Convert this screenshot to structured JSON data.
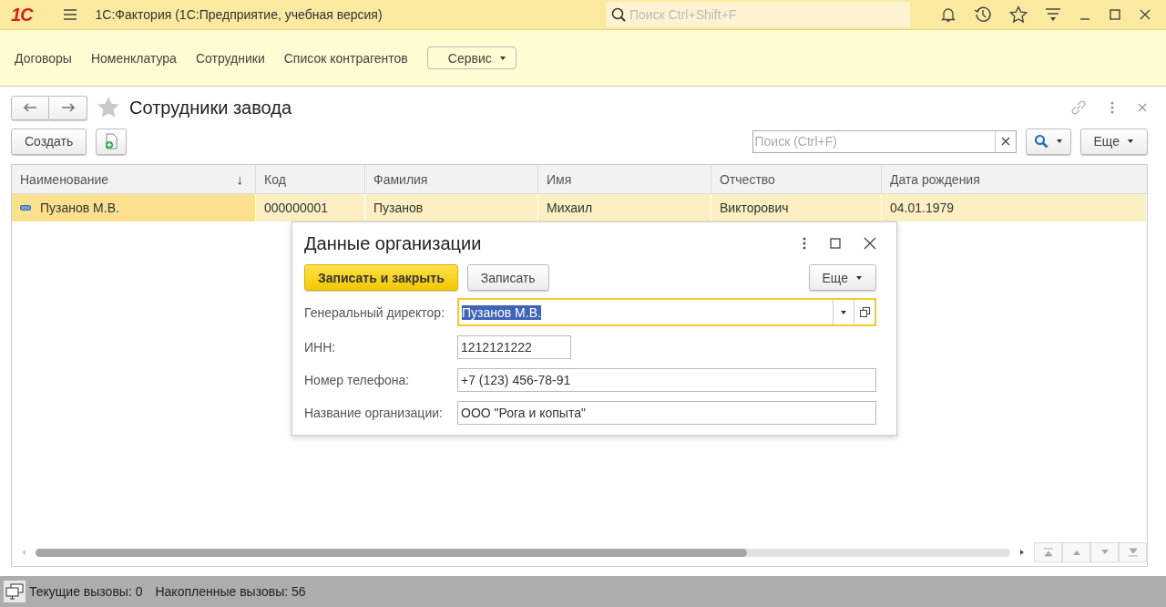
{
  "app": {
    "logo": "1С",
    "title": "1С:Фактория  (1С:Предприятие, учебная версия)"
  },
  "global_search": {
    "placeholder": "Поиск Ctrl+Shift+F"
  },
  "sections": [
    {
      "label": "Договоры"
    },
    {
      "label": "Номенклатура"
    },
    {
      "label": "Сотрудники"
    },
    {
      "label": "Список контрагентов"
    }
  ],
  "service_menu": {
    "label": "Сервис"
  },
  "form": {
    "title": "Сотрудники завода",
    "favorite": false,
    "create_button": "Создать",
    "search": {
      "placeholder": "Поиск (Ctrl+F)"
    },
    "more_button": "Еще"
  },
  "table": {
    "columns": [
      {
        "label": "Наименование",
        "sort_mark": "↓"
      },
      {
        "label": "Код"
      },
      {
        "label": "Фамилия"
      },
      {
        "label": "Имя"
      },
      {
        "label": "Отчество"
      },
      {
        "label": "Дата рождения"
      }
    ],
    "rows": [
      {
        "selected": true,
        "cells": [
          {
            "text": "Пузанов М.В.",
            "current": true
          },
          {
            "text": "000000001",
            "current": false
          },
          {
            "text": "Пузанов",
            "current": false
          },
          {
            "text": "Михаил",
            "current": false
          },
          {
            "text": "Викторович",
            "current": false
          },
          {
            "text": "04.01.1979",
            "current": false
          }
        ]
      }
    ]
  },
  "dialog": {
    "title": "Данные организации",
    "save_close_button": "Записать и закрыть",
    "save_button": "Записать",
    "more_button": "Еще",
    "fields": [
      {
        "kind": "choice",
        "label": "Генеральный директор:",
        "value": "Пузанов М.В.",
        "focused": true,
        "value_selected": true
      },
      {
        "kind": "short",
        "label": "ИНН:",
        "value": "1212121222",
        "focused": false,
        "value_selected": false
      },
      {
        "kind": "text",
        "label": "Номер телефона:",
        "value": "+7 (123) 456-78-91",
        "focused": false,
        "value_selected": false
      },
      {
        "kind": "text",
        "label": "Название организации:",
        "value": "ООО \"Рога и копыта\"",
        "focused": false,
        "value_selected": false
      }
    ]
  },
  "status_bar": {
    "current_calls": "Текущие вызовы: 0",
    "accumulated_calls": "Накопленные вызовы: 56"
  }
}
